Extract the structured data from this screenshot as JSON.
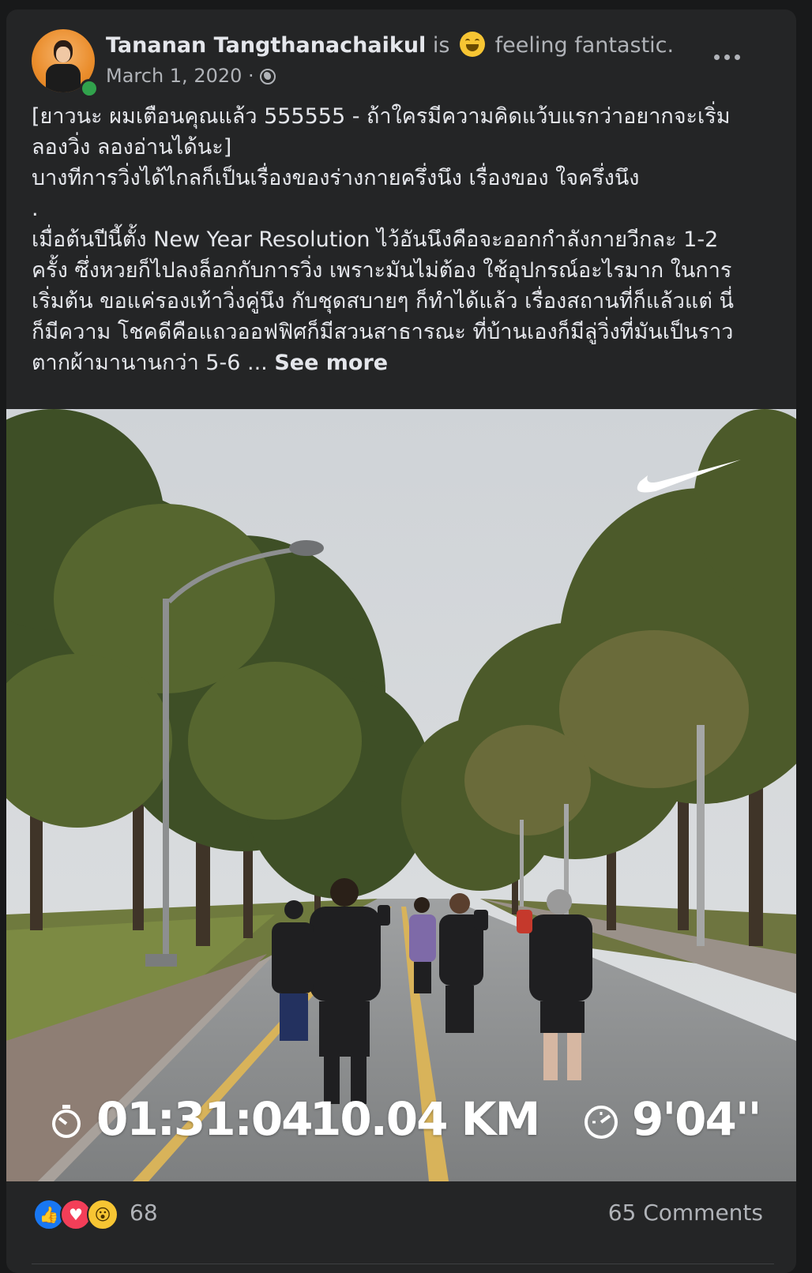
{
  "post": {
    "author_name": "Tananan Tangthanachaikul",
    "feeling_prefix": "is",
    "feeling_icon": "grinning-emoji",
    "feeling_text": "feeling fantastic.",
    "date": "March 1, 2020",
    "date_separator": "·",
    "privacy_icon": "globe-icon",
    "lines": [
      "[ยาวนะ ผมเตือนคุณแล้ว 555555 - ถ้าใครมีความคิดแว้บแรกว่าอยากจะเริ่ม",
      "ลองวิ่ง ลองอ่านได้นะ]",
      "บางทีการวิ่งได้ไกลก็เป็นเรื่องของร่างกายครึ่งนึง เรื่องของ ใจครึ่งนึง",
      ".",
      "เมื่อต้นปีนี้ตั้ง New Year Resolution ไว้อันนึงคือจะออกกำลังกายวีกละ 1-2",
      "ครั้ง ซึ่งหวยก็ไปลงล็อกกับการวิ่ง เพราะมันไม่ต้อง ใช้อุปกรณ์อะไรมาก ในการ",
      "เริ่มต้น ขอแค่รองเท้าวิ่งคู่นึง กับชุดสบายๆ ก็ทำได้แล้ว เรื่องสถานที่ก็แล้วแต่ นี่",
      "ก็มีความ โชคดีคือแถวออฟฟิศก็มีสวนสาธารณะ ที่บ้านเองก็มีลู่วิ่งที่มันเป็นราว"
    ],
    "last_line": "ตากผ้ามานานกว่า 5-6 ... ",
    "see_more": "See more"
  },
  "photo": {
    "stats": {
      "duration": "01:31:04",
      "distance": "10.04 KM",
      "pace": "9'04''"
    },
    "icons": [
      "stopwatch-icon",
      "speedometer-icon",
      "nike-swoosh-logo"
    ]
  },
  "footer": {
    "reaction_icons": [
      "like-icon",
      "love-icon",
      "wow-icon"
    ],
    "reaction_count": "68",
    "comments": "65 Comments"
  },
  "colors": {
    "background": "#18191a",
    "card": "#242526",
    "primary_text": "#e4e6eb",
    "secondary_text": "#b0b3b8",
    "like_blue": "#1877f2",
    "love_red": "#f33e58",
    "wow_yellow": "#f7c533",
    "online_green": "#31a24c"
  }
}
